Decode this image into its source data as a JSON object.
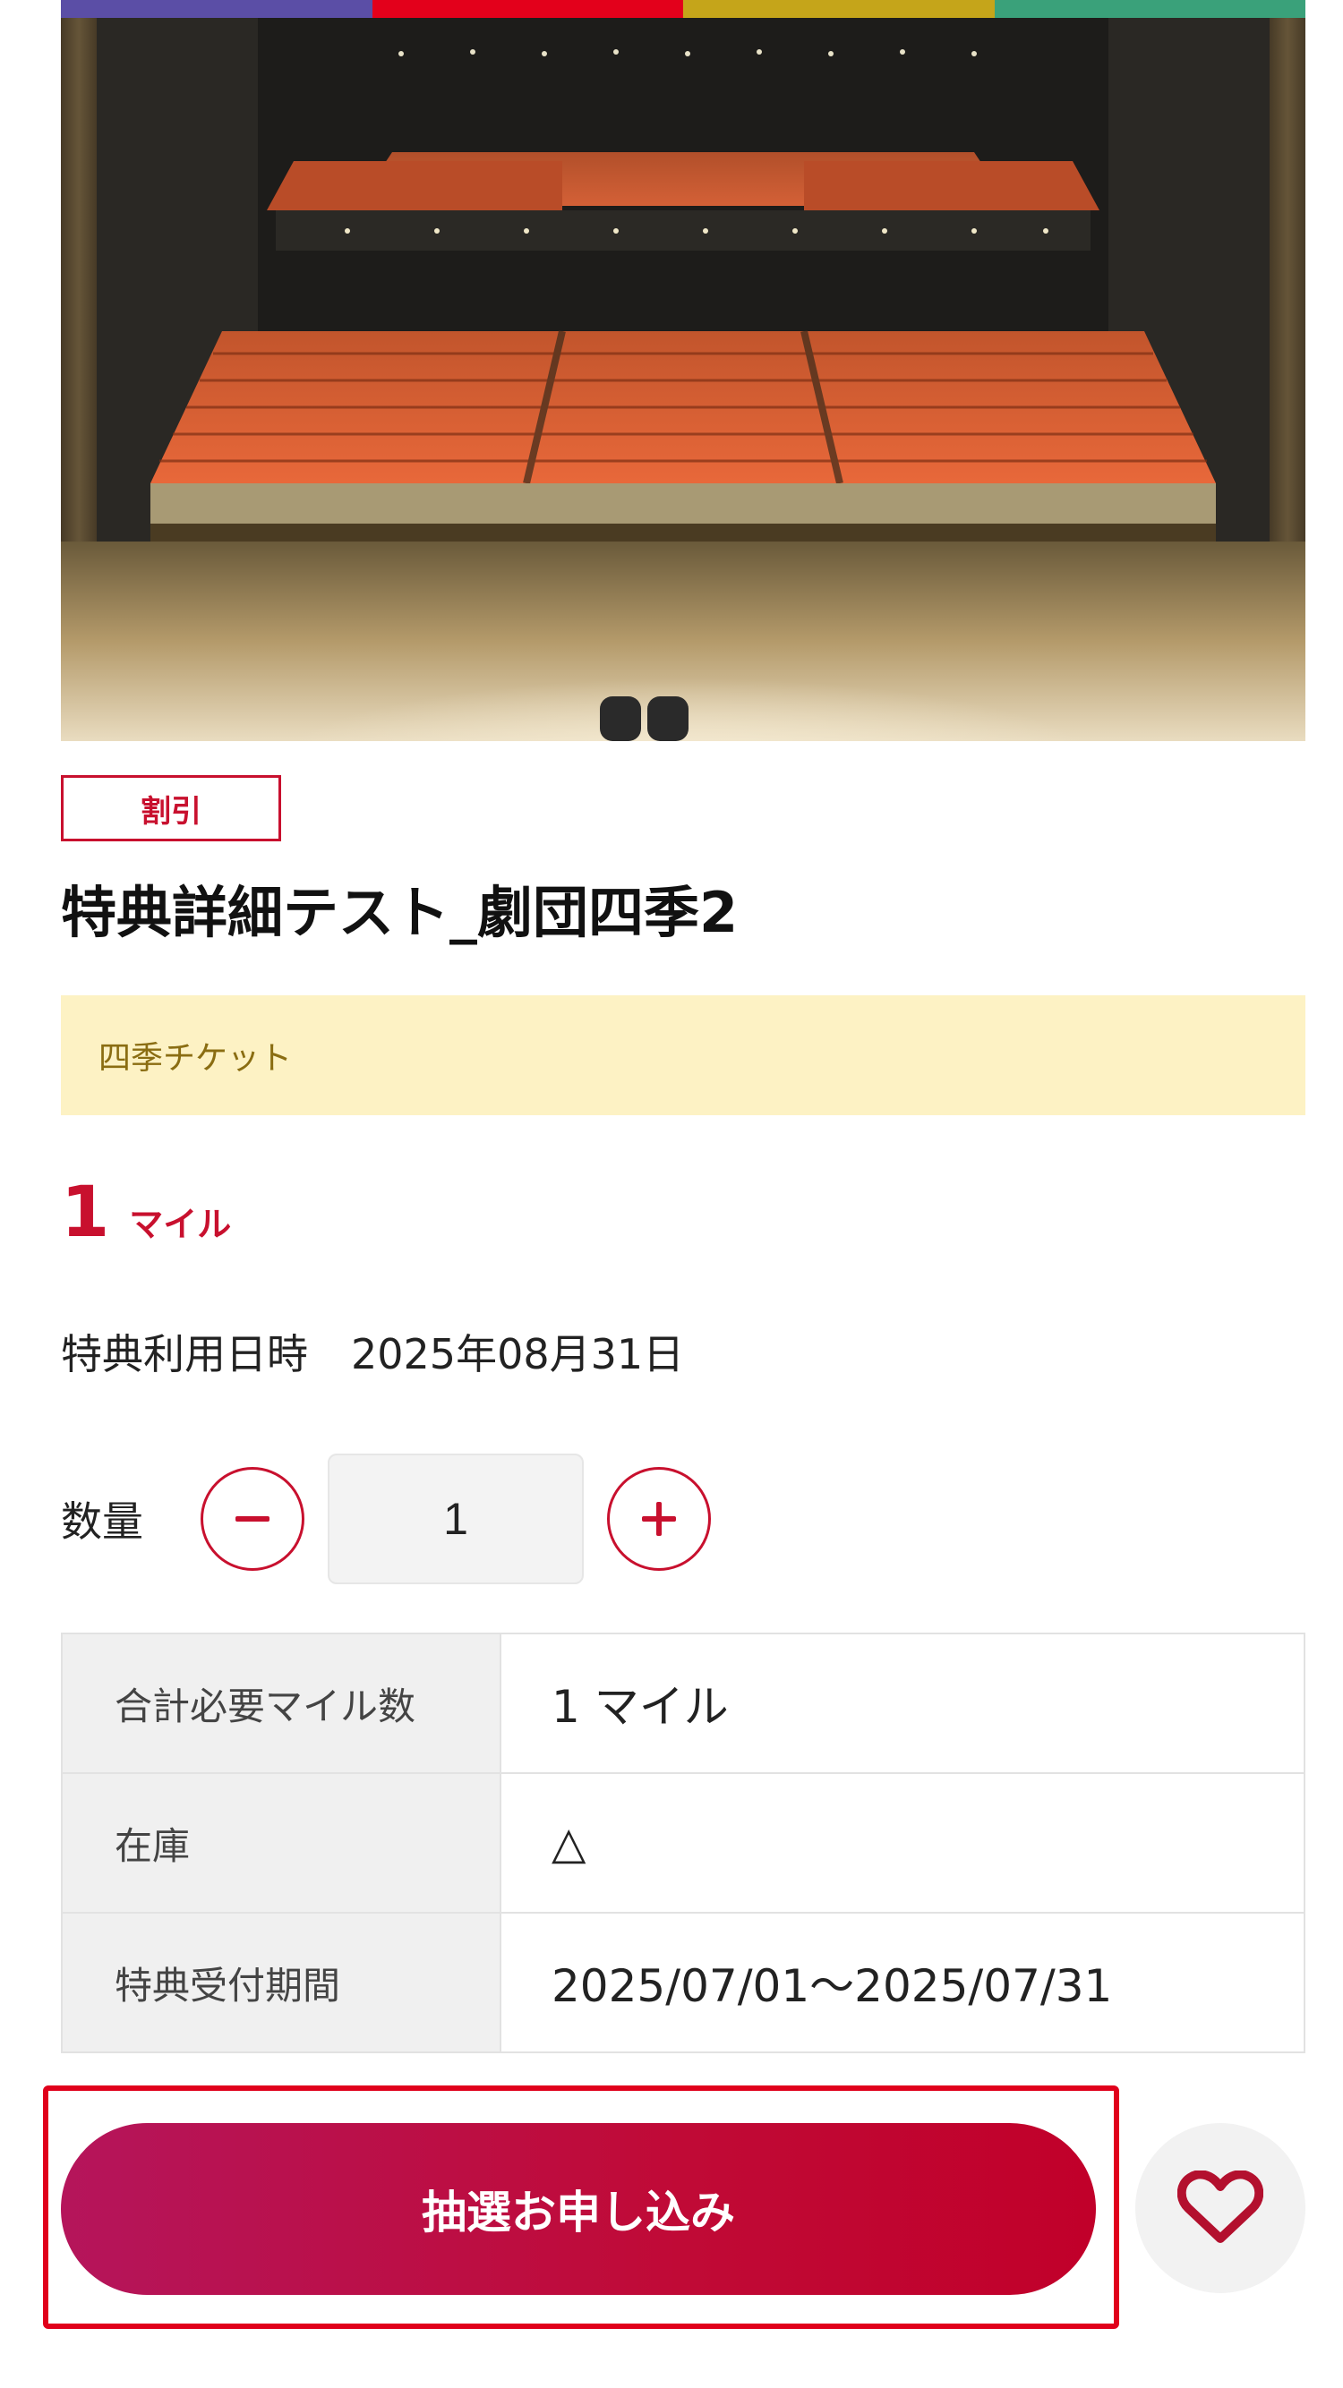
{
  "hero": {
    "image_name": "theater-stage-photo",
    "stripe_colors": [
      "#5b4ea6",
      "#e3001b",
      "#c5a51a",
      "#3aa17a"
    ]
  },
  "product": {
    "tag": "割引",
    "title": "特典詳細テスト_劇団四季2",
    "notice": "四季チケット",
    "mile_value": "1",
    "mile_unit": "マイル",
    "date_label": "特典利用日時",
    "date_value": "2025年08月31日"
  },
  "quantity": {
    "label": "数量",
    "value": "1",
    "minus_icon": "minus-icon",
    "plus_icon": "plus-icon"
  },
  "table": {
    "rows": [
      {
        "label": "合計必要マイル数",
        "value": "1 マイル"
      },
      {
        "label": "在庫",
        "value": "△"
      },
      {
        "label": "特典受付期間",
        "value": "2025/07/01～2025/07/31"
      }
    ]
  },
  "actions": {
    "apply_label": "抽選お申し込み",
    "favorite_icon": "heart-icon"
  },
  "colors": {
    "accent": "#c8102e",
    "notice_bg": "#fdf2c4"
  }
}
